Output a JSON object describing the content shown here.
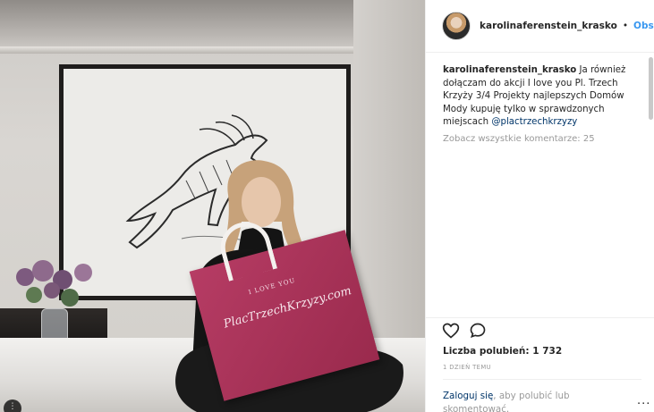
{
  "post": {
    "username": "karolinaferenstein_krasko",
    "separator": "•",
    "follow_label": "Obserwuj",
    "caption_user": "karolinaferenstein_krasko",
    "caption_text": " Ja również dołączam do akcji I love you Pl. Trzech Krzyży 3/4 Projekty najlepszych Domów Mody kupuję tylko w sprawdzonych miejscach ",
    "caption_mention": "@plactrzechkrzyzy",
    "view_all_comments": "Zobacz wszystkie komentarze: 25",
    "likes": "Liczba polubień: 1 732",
    "time_ago": "1 DZIEŃ TEMU",
    "login_link": "Zaloguj się",
    "login_rest": ", aby polubić lub skomentować.",
    "more_label": "···"
  },
  "photo": {
    "bag_small_text": "I LOVE YOU",
    "bag_brand": "PlacTrzechKrzyzy.com",
    "corner_badge": "⋮"
  },
  "icons": {
    "like": "heart-icon",
    "comment": "comment-icon",
    "more": "more-options-icon"
  },
  "colors": {
    "link_blue": "#3897f0",
    "mention": "#003569",
    "muted": "#999999",
    "bag": "#a8325a"
  }
}
